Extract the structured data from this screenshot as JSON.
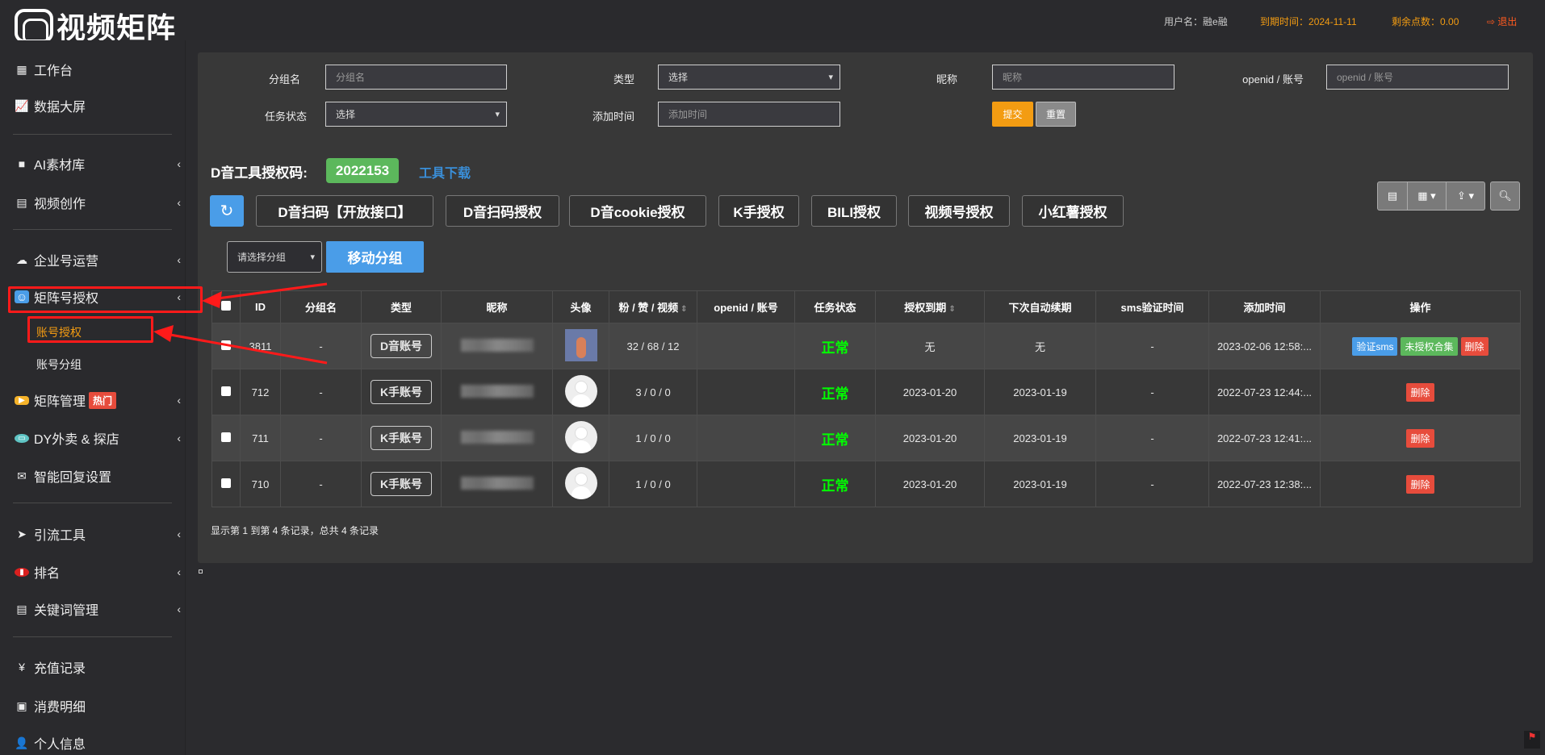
{
  "header": {
    "logo_text": "视频矩阵",
    "username_label": "用户名：",
    "username": "融e融",
    "expiry_label": "到期时间：",
    "expiry": "2024-11-11",
    "points_label": "剩余点数：",
    "points": "0.00",
    "logout": "退出"
  },
  "sidebar": {
    "items": [
      {
        "label": "工作台",
        "icon": "windows-icon"
      },
      {
        "label": "数据大屏",
        "icon": "line-chart-icon"
      },
      {
        "label": "AI素材库",
        "icon": "folder-icon"
      },
      {
        "label": "视频创作",
        "icon": "film-icon"
      },
      {
        "label": "企业号运营",
        "icon": "cloud-icon"
      },
      {
        "label": "矩阵号授权",
        "icon": "user-icon",
        "sub": [
          "账号授权",
          "账号分组"
        ]
      },
      {
        "label": "矩阵管理",
        "icon": "play-icon",
        "badge": "热门"
      },
      {
        "label": "DY外卖 & 探店",
        "icon": "store-icon"
      },
      {
        "label": "智能回复设置",
        "icon": "envelope-icon"
      },
      {
        "label": "引流工具",
        "icon": "paper-plane-icon"
      },
      {
        "label": "排名",
        "icon": "bar-chart-icon"
      },
      {
        "label": "关键词管理",
        "icon": "file-icon"
      },
      {
        "label": "充值记录",
        "icon": "yen-icon"
      },
      {
        "label": "消费明细",
        "icon": "money-icon"
      },
      {
        "label": "个人信息",
        "icon": "person-icon"
      }
    ]
  },
  "filters": {
    "group_label": "分组名",
    "group_placeholder": "分组名",
    "type_label": "类型",
    "type_value": "选择",
    "nick_label": "昵称",
    "nick_placeholder": "昵称",
    "openid_label": "openid / 账号",
    "openid_placeholder": "openid / 账号",
    "status_label": "任务状态",
    "status_value": "选择",
    "time_label": "添加时间",
    "time_placeholder": "添加时间",
    "submit": "提交",
    "reset": "重置"
  },
  "auth": {
    "code_label": "D音工具授权码:",
    "code": "2022153",
    "download": "工具下载",
    "buttons": [
      "D音扫码【开放接口】",
      "D音扫码授权",
      "D音cookie授权",
      "K手授权",
      "BILI授权",
      "视频号授权",
      "小红薯授权"
    ],
    "group_select": "请选择分组",
    "move_group": "移动分组"
  },
  "table": {
    "headers": [
      "ID",
      "分组名",
      "类型",
      "昵称",
      "头像",
      "粉 / 赞 / 视频",
      "openid / 账号",
      "任务状态",
      "授权到期",
      "下次自动续期",
      "sms验证时间",
      "添加时间",
      "操作"
    ],
    "rows": [
      {
        "id": "3811",
        "group": "-",
        "type": "D音账号",
        "fans": "32 / 68 / 12",
        "openid": "",
        "status": "正常",
        "expire": "无",
        "renew": "无",
        "sms": "-",
        "added": "2023-02-06 12:58:...",
        "ops": [
          "验证sms",
          "未授权合集",
          "删除"
        ]
      },
      {
        "id": "712",
        "group": "-",
        "type": "K手账号",
        "fans": "3 / 0 / 0",
        "openid": "",
        "status": "正常",
        "expire": "2023-01-20",
        "renew": "2023-01-19",
        "sms": "-",
        "added": "2022-07-23 12:44:...",
        "ops": [
          "删除"
        ]
      },
      {
        "id": "711",
        "group": "-",
        "type": "K手账号",
        "fans": "1 / 0 / 0",
        "openid": "",
        "status": "正常",
        "expire": "2023-01-20",
        "renew": "2023-01-19",
        "sms": "-",
        "added": "2022-07-23 12:41:...",
        "ops": [
          "删除"
        ]
      },
      {
        "id": "710",
        "group": "-",
        "type": "K手账号",
        "fans": "1 / 0 / 0",
        "openid": "",
        "status": "正常",
        "expire": "2023-01-20",
        "renew": "2023-01-19",
        "sms": "-",
        "added": "2022-07-23 12:38:...",
        "ops": [
          "删除"
        ]
      }
    ],
    "footer": "显示第 1 到第 4 条记录，总共 4 条记录"
  },
  "colors": {
    "accent_blue": "#4a9de8",
    "green": "#5cb85c",
    "red": "#e74c3c",
    "orange": "#f39c12",
    "status_ok": "#00ff00",
    "annotation_red": "#ff1a1a"
  }
}
